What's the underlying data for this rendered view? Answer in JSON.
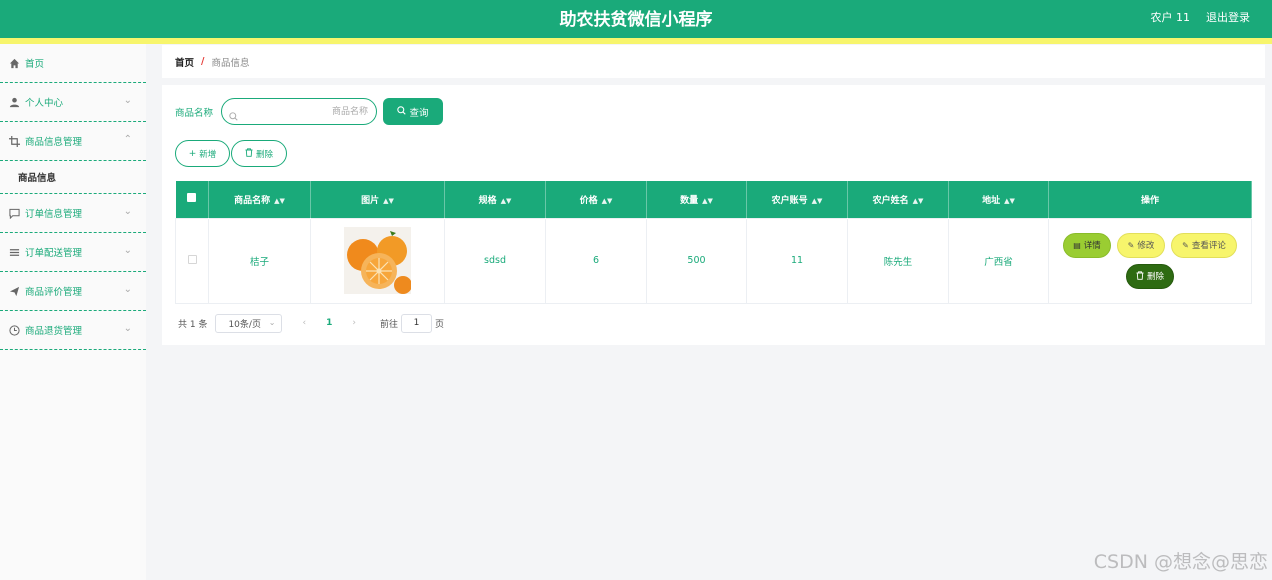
{
  "header": {
    "title": "助农扶贫微信小程序",
    "user": "农户 11",
    "logout": "退出登录"
  },
  "sidebar": {
    "items": [
      {
        "label": "首页",
        "icon": "home-icon"
      },
      {
        "label": "个人中心",
        "icon": "user-icon"
      },
      {
        "label": "商品信息管理",
        "icon": "crop-icon"
      },
      {
        "label": "订单信息管理",
        "icon": "message-icon"
      },
      {
        "label": "订单配送管理",
        "icon": "list-icon"
      },
      {
        "label": "商品评价管理",
        "icon": "send-icon"
      },
      {
        "label": "商品退货管理",
        "icon": "clock-icon"
      }
    ],
    "submenu": {
      "label": "商品信息"
    }
  },
  "breadcrumb": {
    "home": "首页",
    "separator": "/",
    "current": "商品信息"
  },
  "search": {
    "label": "商品名称",
    "placeholder": "商品名称",
    "query_button": "查询"
  },
  "actions": {
    "add": "新增",
    "delete": "删除"
  },
  "table": {
    "columns": [
      "商品名称",
      "图片",
      "规格",
      "价格",
      "数量",
      "农户账号",
      "农户姓名",
      "地址",
      "操作"
    ],
    "rows": [
      {
        "name": "桔子",
        "spec": "sdsd",
        "price": "6",
        "quantity": "500",
        "farmer_account": "11",
        "farmer_name": "陈先生",
        "address": "广西省",
        "ops": {
          "detail": "详情",
          "edit": "修改",
          "comments": "查看评论",
          "delete": "删除"
        }
      }
    ]
  },
  "pagination": {
    "total": "共 1 条",
    "page_size": "10条/页",
    "current_page": "1",
    "goto_label": "前往",
    "goto_value": "1",
    "goto_suffix": "页"
  },
  "watermark": "CSDN @想念@思恋",
  "colors": {
    "primary": "#1aaa7a",
    "accent_yellow": "#f7f56c",
    "detail_green": "#9acd32",
    "delete_dark": "#2e6b12"
  }
}
